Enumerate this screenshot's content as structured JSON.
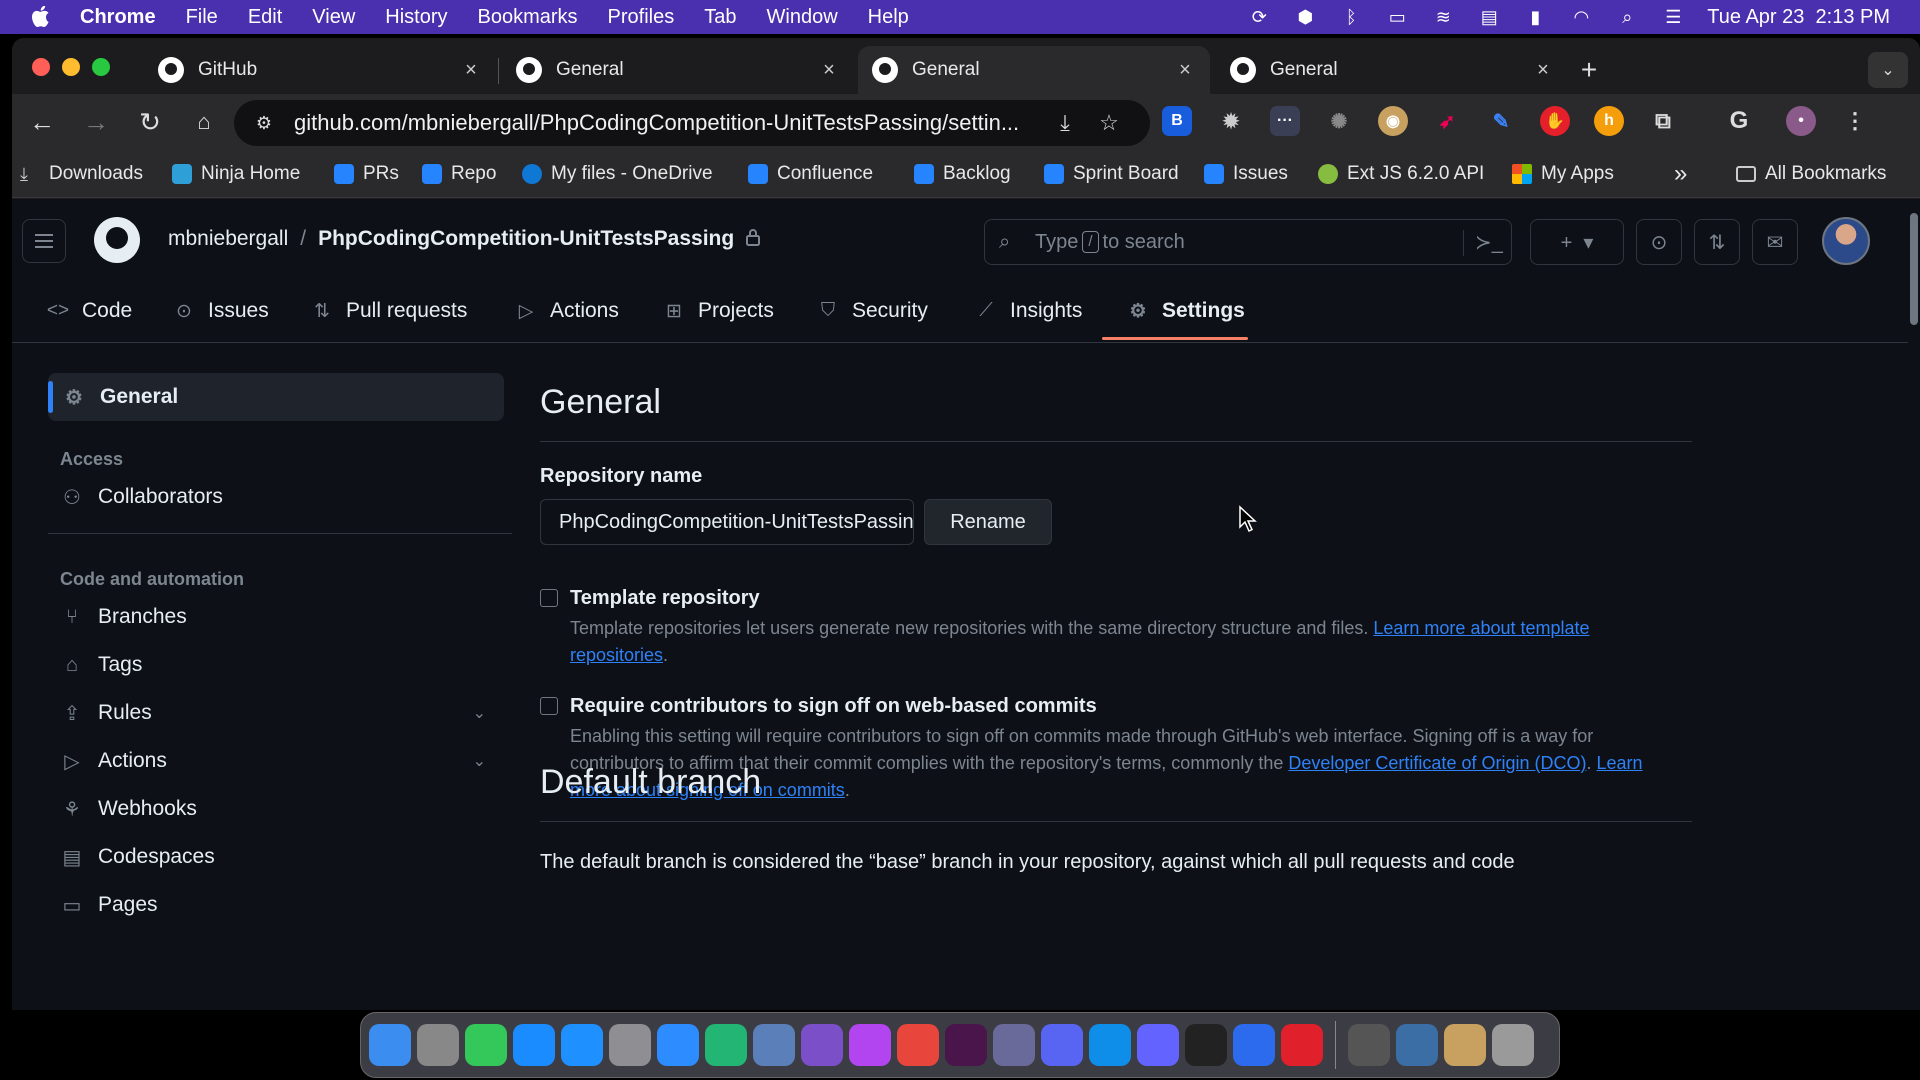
{
  "menubar": {
    "app": "Chrome",
    "menus": [
      "File",
      "Edit",
      "View",
      "History",
      "Bookmarks",
      "Profiles",
      "Tab",
      "Window",
      "Help"
    ],
    "datetime": "Tue Apr 23  2:13 PM"
  },
  "tabs": [
    {
      "title": "GitHub",
      "active": false
    },
    {
      "title": "General",
      "active": false
    },
    {
      "title": "General",
      "active": true
    },
    {
      "title": "General",
      "active": false
    }
  ],
  "toolbar": {
    "url": "github.com/mbniebergall/PhpCodingCompetition-UnitTestsPassing/settin..."
  },
  "bookmarks": [
    {
      "label": "Downloads",
      "color": "#cccccc"
    },
    {
      "label": "Ninja Home",
      "color": "#2f9fd8"
    },
    {
      "label": "PRs",
      "color": "#2684ff"
    },
    {
      "label": "Repo",
      "color": "#2684ff"
    },
    {
      "label": "My files - OneDrive",
      "color": "#0f78d4"
    },
    {
      "label": "Confluence",
      "color": "#2684ff"
    },
    {
      "label": "Backlog",
      "color": "#2684ff"
    },
    {
      "label": "Sprint Board",
      "color": "#2684ff"
    },
    {
      "label": "Issues",
      "color": "#2684ff"
    },
    {
      "label": "Ext JS 6.2.0 API",
      "color": "#86bc40"
    },
    {
      "label": "My Apps",
      "color": "#f25022"
    }
  ],
  "bookmarks_overflow": "»",
  "all_bookmarks": "All Bookmarks",
  "github": {
    "owner": "mbniebergall",
    "separator": "/",
    "repo": "PhpCodingCompetition-UnitTestsPassing",
    "search": {
      "prefix": "Type",
      "key": "/",
      "suffix": "to search"
    },
    "repo_tabs": [
      {
        "label": "Code",
        "icon": "code-icon"
      },
      {
        "label": "Issues",
        "icon": "issue-opened-icon"
      },
      {
        "label": "Pull requests",
        "icon": "git-pull-request-icon"
      },
      {
        "label": "Actions",
        "icon": "play-icon"
      },
      {
        "label": "Projects",
        "icon": "table-icon"
      },
      {
        "label": "Security",
        "icon": "shield-icon"
      },
      {
        "label": "Insights",
        "icon": "graph-icon"
      },
      {
        "label": "Settings",
        "icon": "gear-icon",
        "selected": true
      }
    ],
    "sidebar": {
      "general": "General",
      "access_heading": "Access",
      "access_items": [
        {
          "label": "Collaborators",
          "icon": "people-icon"
        }
      ],
      "code_heading": "Code and automation",
      "code_items": [
        {
          "label": "Branches",
          "icon": "git-branch-icon"
        },
        {
          "label": "Tags",
          "icon": "tag-icon"
        },
        {
          "label": "Rules",
          "icon": "repo-push-icon",
          "expandable": true
        },
        {
          "label": "Actions",
          "icon": "play-icon",
          "expandable": true
        },
        {
          "label": "Webhooks",
          "icon": "webhook-icon"
        },
        {
          "label": "Codespaces",
          "icon": "codespaces-icon"
        },
        {
          "label": "Pages",
          "icon": "browser-icon"
        }
      ]
    },
    "main": {
      "title": "General",
      "repo_name_label": "Repository name",
      "repo_name_value": "PhpCodingCompetition-UnitTestsPassing",
      "rename_label": "Rename",
      "template": {
        "title": "Template repository",
        "desc": "Template repositories let users generate new repositories with the same directory structure and files.",
        "link": "Learn more about template repositories",
        "checked": false
      },
      "signoff": {
        "title": "Require contributors to sign off on web-based commits",
        "desc": "Enabling this setting will require contributors to sign off on commits made through GitHub's web interface. Signing off is a way for contributors to affirm that their commit complies with the repository's terms, commonly the",
        "link1": "Developer Certificate of Origin (DCO)",
        "link2": "Learn more about signing off on commits",
        "checked": false
      },
      "default_branch_title": "Default branch",
      "default_branch_desc": "The default branch is considered the “base” branch in your repository, against which all pull requests and code"
    }
  },
  "dock_apps": [
    {
      "name": "finder-icon",
      "color": "#3b8ef0"
    },
    {
      "name": "launchpad-icon",
      "color": "#888888"
    },
    {
      "name": "messages-icon",
      "color": "#34c759"
    },
    {
      "name": "keynote-icon",
      "color": "#1a8cff"
    },
    {
      "name": "app-store-icon",
      "color": "#1e90ff"
    },
    {
      "name": "system-settings-icon",
      "color": "#8e8e93"
    },
    {
      "name": "zoom-icon",
      "color": "#2d8cff"
    },
    {
      "name": "clion-icon",
      "color": "#22b573"
    },
    {
      "name": "virtualbox-icon",
      "color": "#5b7fb8"
    },
    {
      "name": "github-desktop-icon",
      "color": "#7b4fc7"
    },
    {
      "name": "phpstorm-icon",
      "color": "#b345f1"
    },
    {
      "name": "chrome-icon",
      "color": "#e8453c"
    },
    {
      "name": "slack-icon",
      "color": "#4a154b"
    },
    {
      "name": "bbedit-icon",
      "color": "#6a6a9a"
    },
    {
      "name": "discord-icon",
      "color": "#5865f2"
    },
    {
      "name": "teamviewer-icon",
      "color": "#0e8ee9"
    },
    {
      "name": "mastodon-icon",
      "color": "#6364ff"
    },
    {
      "name": "terminal-icon",
      "color": "#222222"
    },
    {
      "name": "signal-icon",
      "color": "#2c6bed"
    },
    {
      "name": "bitdefender-icon",
      "color": "#e0202a"
    },
    {
      "name": "calculator-icon",
      "color": "#555555"
    },
    {
      "name": "screenshot-icon",
      "color": "#3a6ea5"
    },
    {
      "name": "preview-icon",
      "color": "#c8a060"
    },
    {
      "name": "trash-icon",
      "color": "#9a9a9a"
    }
  ]
}
